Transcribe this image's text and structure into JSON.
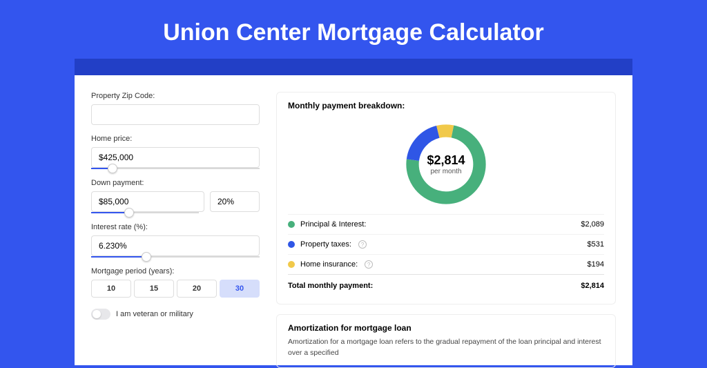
{
  "title": "Union Center Mortgage Calculator",
  "form": {
    "zip_label": "Property Zip Code:",
    "zip_value": "",
    "home_price_label": "Home price:",
    "home_price_value": "$425,000",
    "home_price_slider_pct": 10,
    "down_payment_label": "Down payment:",
    "down_payment_value": "$85,000",
    "down_payment_pct": "20%",
    "down_payment_slider_pct": 20,
    "interest_label": "Interest rate (%):",
    "interest_value": "6.230%",
    "interest_slider_pct": 30,
    "period_label": "Mortgage period (years):",
    "periods": [
      "10",
      "15",
      "20",
      "30"
    ],
    "period_active_index": 3,
    "veteran_label": "I am veteran or military"
  },
  "breakdown": {
    "title": "Monthly payment breakdown:",
    "donut_amount": "$2,814",
    "donut_sub": "per month",
    "items": [
      {
        "label": "Principal & Interest:",
        "value": "$2,089",
        "color": "green"
      },
      {
        "label": "Property taxes:",
        "value": "$531",
        "color": "blue",
        "info": true
      },
      {
        "label": "Home insurance:",
        "value": "$194",
        "color": "yellow",
        "info": true
      }
    ],
    "total_label": "Total monthly payment:",
    "total_value": "$2,814"
  },
  "amortization": {
    "title": "Amortization for mortgage loan",
    "text": "Amortization for a mortgage loan refers to the gradual repayment of the loan principal and interest over a specified"
  },
  "chart_data": {
    "type": "pie",
    "title": "Monthly payment breakdown",
    "series": [
      {
        "name": "Principal & Interest",
        "value": 2089,
        "color": "#47b07c"
      },
      {
        "name": "Property taxes",
        "value": 531,
        "color": "#2f56e6"
      },
      {
        "name": "Home insurance",
        "value": 194,
        "color": "#f1c94a"
      }
    ],
    "total": 2814,
    "center_label": "$2,814 per month"
  }
}
